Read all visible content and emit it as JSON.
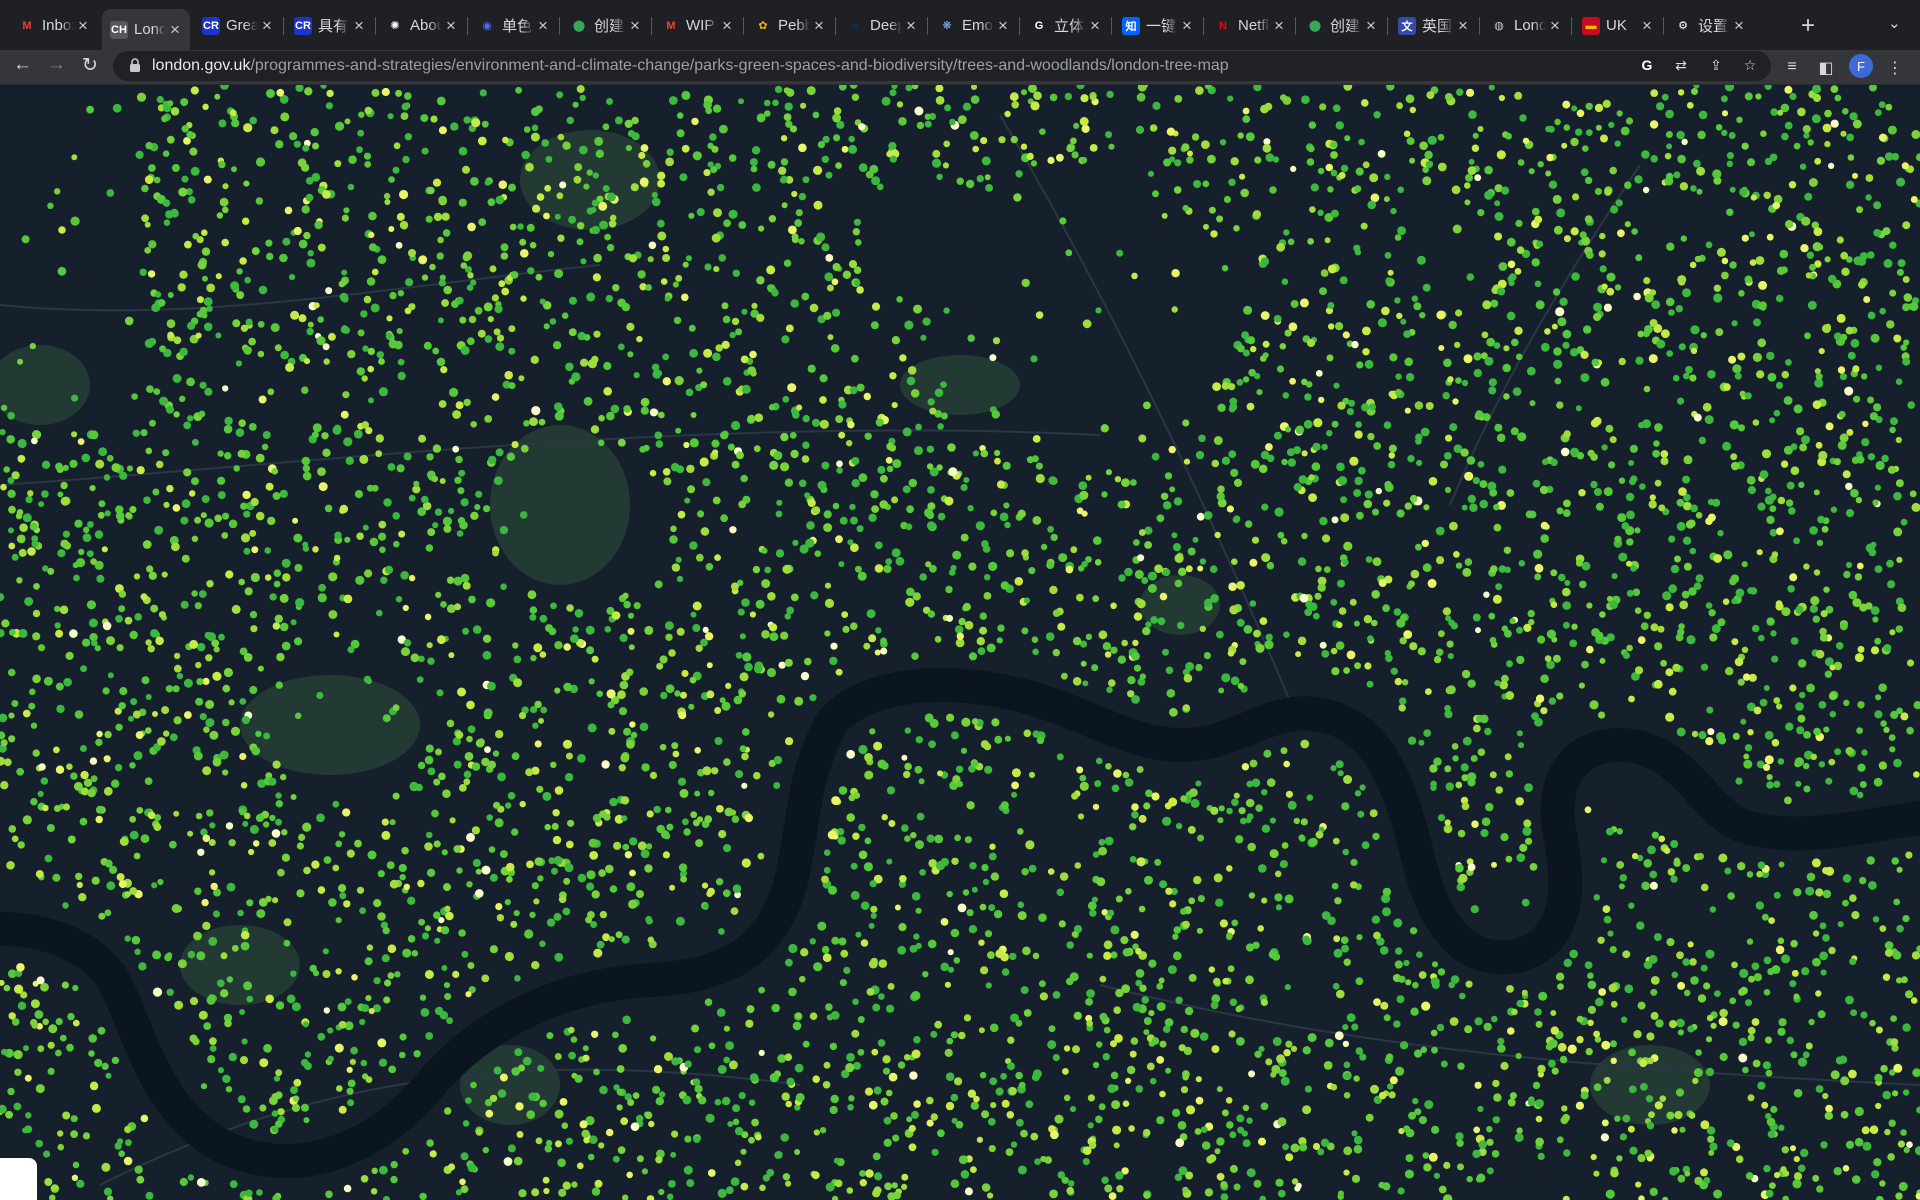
{
  "tabs": [
    {
      "title": "Inbox",
      "icon": "gmail-icon",
      "favtext": "M",
      "favcolor": "#ea4335",
      "favbg": "transparent",
      "active": false
    },
    {
      "title": "London",
      "icon": "companies-house-icon",
      "favtext": "CH",
      "favcolor": "#ffffff",
      "favbg": "#55575c",
      "active": true
    },
    {
      "title": "Great",
      "icon": "cr-icon",
      "favtext": "CR",
      "favcolor": "#ffffff",
      "favbg": "#1a35c7",
      "active": false
    },
    {
      "title": "具有",
      "icon": "cr-icon",
      "favtext": "CR",
      "favcolor": "#ffffff",
      "favbg": "#1a35c7",
      "active": false
    },
    {
      "title": "About",
      "icon": "openai-icon",
      "favtext": "✺",
      "favcolor": "#ffffff",
      "favbg": "transparent",
      "active": false
    },
    {
      "title": "单色",
      "icon": "blue-circle-icon",
      "favtext": "◉",
      "favcolor": "#4b6bff",
      "favbg": "transparent",
      "active": false
    },
    {
      "title": "创建",
      "icon": "map-pin-icon",
      "favtext": "⬤",
      "favcolor": "#34a853",
      "favbg": "transparent",
      "active": false
    },
    {
      "title": "WIP",
      "icon": "gmail-icon",
      "favtext": "M",
      "favcolor": "#ea4335",
      "favbg": "transparent",
      "active": false
    },
    {
      "title": "Pebble",
      "icon": "pebble-icon",
      "favtext": "✿",
      "favcolor": "#f4b400",
      "favbg": "transparent",
      "active": false
    },
    {
      "title": "DeepL",
      "icon": "deepl-icon",
      "favtext": "◆",
      "favcolor": "#0f2b46",
      "favbg": "transparent",
      "active": false
    },
    {
      "title": "Emoji",
      "icon": "emoji-icon",
      "favtext": "❋",
      "favcolor": "#8ab4f8",
      "favbg": "transparent",
      "active": false
    },
    {
      "title": "立体",
      "icon": "google-icon",
      "favtext": "G",
      "favcolor": "#ffffff",
      "favbg": "transparent",
      "active": false
    },
    {
      "title": "一键",
      "icon": "zhihu-icon",
      "favtext": "知",
      "favcolor": "#ffffff",
      "favbg": "#0066ff",
      "active": false
    },
    {
      "title": "Netflix",
      "icon": "netflix-icon",
      "favtext": "N",
      "favcolor": "#e50914",
      "favbg": "transparent",
      "active": false
    },
    {
      "title": "创建",
      "icon": "map-pin-icon",
      "favtext": "⬤",
      "favcolor": "#34a853",
      "favbg": "transparent",
      "active": false
    },
    {
      "title": "英国",
      "icon": "translate-icon",
      "favtext": "文",
      "favcolor": "#ffffff",
      "favbg": "#3949ab",
      "active": false
    },
    {
      "title": "London",
      "icon": "globe-icon",
      "favtext": "◍",
      "favcolor": "#c8c9cc",
      "favbg": "transparent",
      "active": false
    },
    {
      "title": "UK",
      "icon": "spain-flag-icon",
      "favtext": "▬",
      "favcolor": "#f1bf00",
      "favbg": "#c60b1e",
      "active": false
    },
    {
      "title": "设置",
      "icon": "settings-gear-icon",
      "favtext": "⚙",
      "favcolor": "#ffffff",
      "favbg": "transparent",
      "active": false
    }
  ],
  "url": {
    "host": "london.gov.uk",
    "path": "/programmes-and-strategies/environment-and-climate-change/parks-green-spaces-and-biodiversity/trees-and-woodlands/london-tree-map"
  },
  "profile": {
    "initial": "F"
  },
  "map": {
    "background": "#16202c",
    "land": "#1e2a38",
    "park": "#223a33",
    "river": "#0b1520",
    "road": "#2a3646",
    "tree_colors": [
      "#3cb83f",
      "#56c93a",
      "#78d33a",
      "#9fdd3c",
      "#c7ea47",
      "#e8f46a",
      "#f6fbc8"
    ]
  }
}
